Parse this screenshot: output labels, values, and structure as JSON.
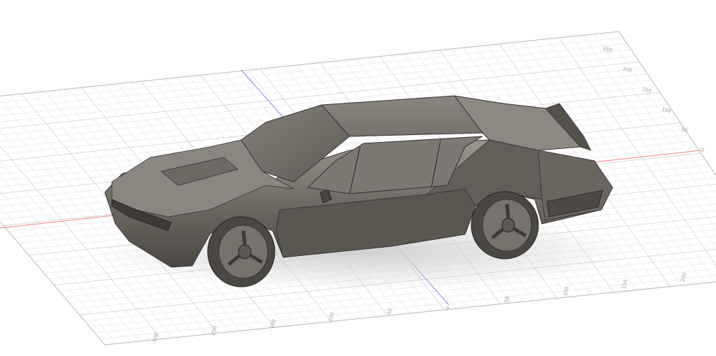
{
  "viewport": {
    "ground_grid": {
      "side_axis_ticks": [
        "0",
        "50",
        "100",
        "150",
        "200",
        "250"
      ],
      "front_axis_ticks": [
        "-250",
        "-200",
        "-150",
        "-100",
        "-50",
        "0",
        "50",
        "100",
        "150",
        "200"
      ]
    },
    "colors": {
      "x_axis": "#f08080",
      "z_axis": "#8080f0",
      "grid_major": "#c8c8c8",
      "grid_minor": "#e8e8e8",
      "body": "#6e6a64"
    },
    "model": "car-body"
  }
}
